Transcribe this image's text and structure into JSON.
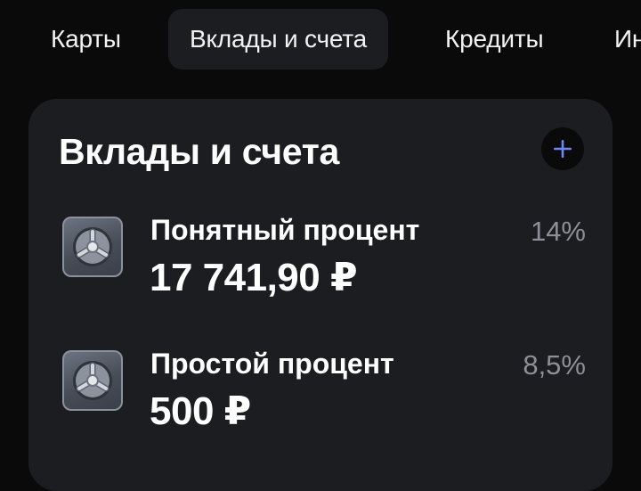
{
  "tabs": [
    {
      "label": "Карты",
      "active": false
    },
    {
      "label": "Вклады и счета",
      "active": true
    },
    {
      "label": "Кредиты",
      "active": false
    },
    {
      "label": "Ин",
      "active": false
    }
  ],
  "card": {
    "title": "Вклады и счета",
    "add_icon": "plus-icon",
    "accent_color": "#6e86f7",
    "accounts": [
      {
        "name": "Понятный процент",
        "amount": "17 741,90 ₽",
        "rate": "14%",
        "icon": "safe-icon"
      },
      {
        "name": "Простой процент",
        "amount": "500 ₽",
        "rate": "8,5%",
        "icon": "safe-icon"
      }
    ]
  }
}
